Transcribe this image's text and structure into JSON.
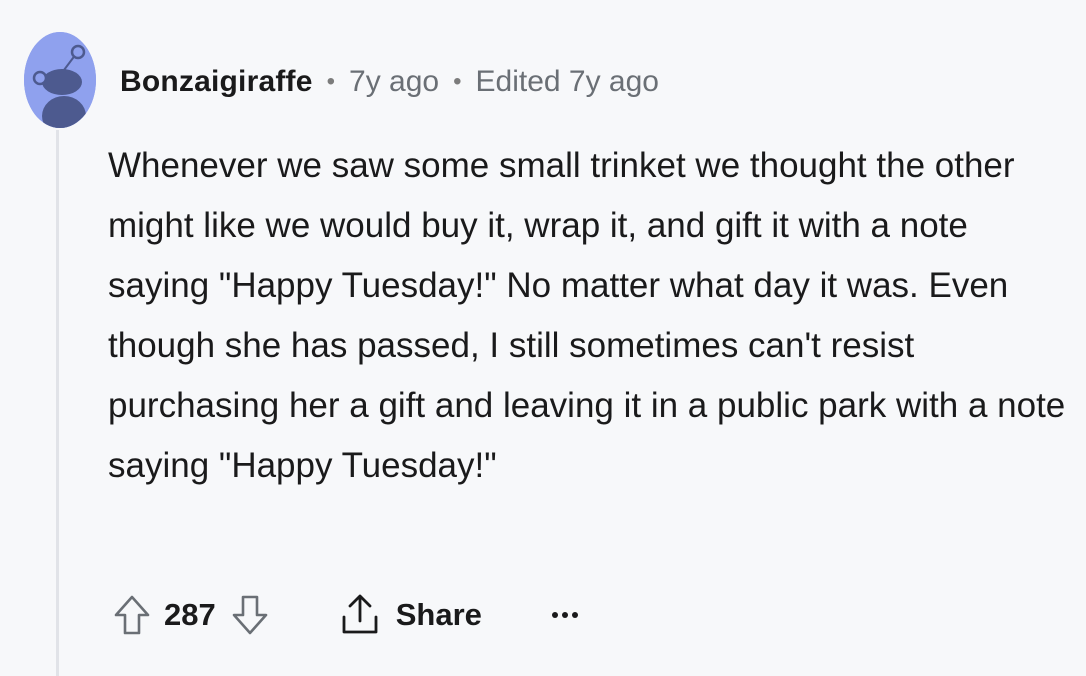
{
  "comment": {
    "author": "Bonzaigiraffe",
    "separator": "•",
    "posted": "7y ago",
    "edited": "Edited 7y ago",
    "body": "Whenever we saw some small trinket we thought the other might like we would buy it, wrap it, and gift it with a note saying \"Happy Tuesday!\" No matter what day it was. Even though she has passed, I still sometimes can't resist purchasing her a gift and leaving it in a public park with a note saying \"Happy Tuesday!\"",
    "score": "287",
    "share_label": "Share"
  },
  "icons": {
    "avatar": "snoo-avatar-icon",
    "upvote": "upvote-arrow-icon",
    "downvote": "downvote-arrow-icon",
    "share": "share-icon",
    "more": "more-options-icon"
  },
  "colors": {
    "background": "#f7f8fa",
    "avatar_bg": "#8fa1ee",
    "text": "#1a1a1b",
    "muted": "#6a6f75",
    "thread_line": "#e1e3e8"
  }
}
